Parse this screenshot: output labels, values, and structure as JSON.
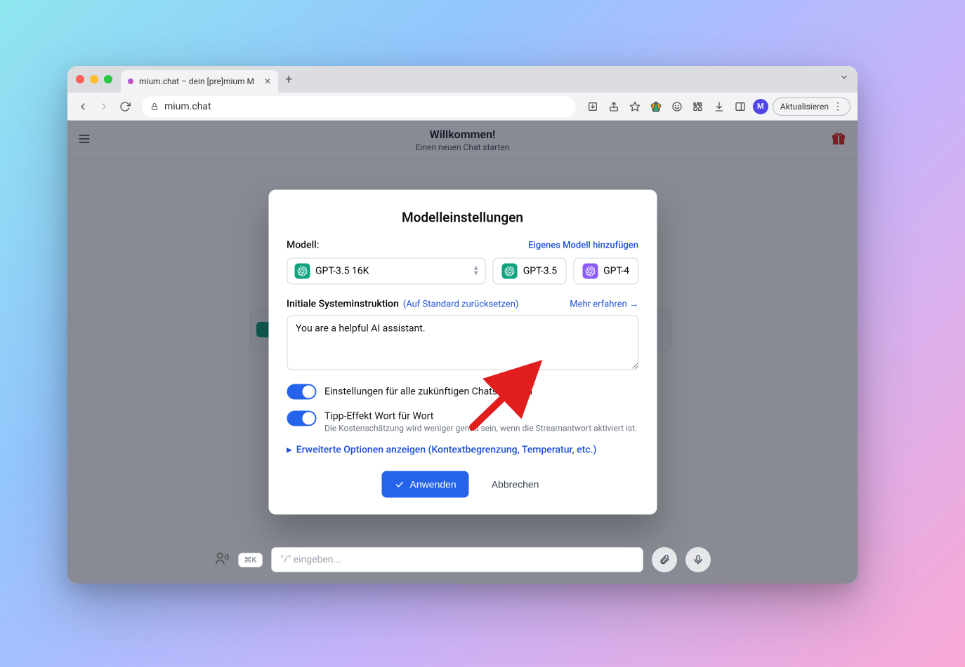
{
  "browser": {
    "tab_title": "mium.chat – dein [pre]mium M",
    "address": "mium.chat",
    "update_label": "Aktualisieren",
    "avatar_initial": "M"
  },
  "page": {
    "top_title": "Willkommen!",
    "top_subtitle": "Einen neuen Chat starten",
    "composer_kbd": "⌘K",
    "composer_placeholder": "\"/\" eingeben..."
  },
  "modal": {
    "title": "Modelleinstellungen",
    "model_label": "Modell:",
    "add_custom_model": "Eigenes Modell hinzufügen",
    "model_selected": "GPT-3.5 16K",
    "quick_models": [
      {
        "name": "GPT-3.5",
        "badge": "green"
      },
      {
        "name": "GPT-4",
        "badge": "purple"
      }
    ],
    "sysinstr_label": "Initiale Systeminstruktion",
    "sysinstr_reset": "(Auf Standard zurücksetzen)",
    "more_link": "Mehr erfahren →",
    "sysinstr_value": "You are a helpful AI assistant.",
    "switch_remember": "Einstellungen für alle zukünftigen Chats merken",
    "switch_stream": "Tipp-Effekt Wort für Wort",
    "switch_stream_hint": "Die Kostenschätzung wird weniger genau sein, wenn die Streamantwort aktiviert ist.",
    "advanced": "Erweiterte Optionen anzeigen (Kontextbegrenzung, Temperatur, etc.)",
    "apply": "Anwenden",
    "cancel": "Abbrechen"
  }
}
